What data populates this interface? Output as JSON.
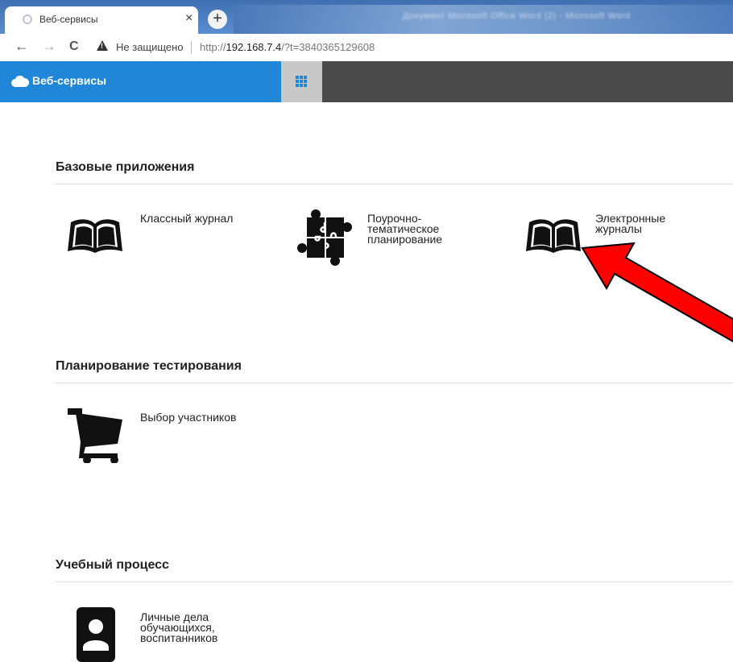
{
  "browser": {
    "tab_title": "Веб-сервисы",
    "tab_close": "×",
    "new_tab": "+",
    "back": "←",
    "forward": "→",
    "reload": "C",
    "security_label": "Не защищено",
    "url_scheme": "http://",
    "url_host": "192.168.7.4",
    "url_path": "/?t=3840365129608",
    "other_window_title": "Документ Microsoft Office Word (2) - Microsoft Word"
  },
  "header": {
    "brand": "Веб-сервисы"
  },
  "sections": [
    {
      "title": "Базовые приложения",
      "items": [
        {
          "label": "Классный журнал",
          "icon": "book-icon"
        },
        {
          "label": "Поурочно-тематическое планирование",
          "lines": [
            "Поурочно-",
            "тематическое",
            "планирование"
          ],
          "icon": "puzzle-icon"
        },
        {
          "label": "Электронные журналы",
          "lines": [
            "Электронные",
            "журналы"
          ],
          "icon": "book-icon"
        }
      ]
    },
    {
      "title": "Планирование тестирования",
      "items": [
        {
          "label": "Выбор участников",
          "icon": "cart-icon"
        }
      ]
    },
    {
      "title": "Учебный процесс",
      "items": [
        {
          "label": "Личные дела обучающихся, воспитанников",
          "lines": [
            "Личные дела",
            "обучающихся,",
            "воспитанников"
          ],
          "icon": "person-card-icon"
        }
      ]
    }
  ],
  "colors": {
    "brand_blue": "#1f86d8",
    "header_dark": "#4a4a4a",
    "arrow_red": "#ff0000"
  }
}
